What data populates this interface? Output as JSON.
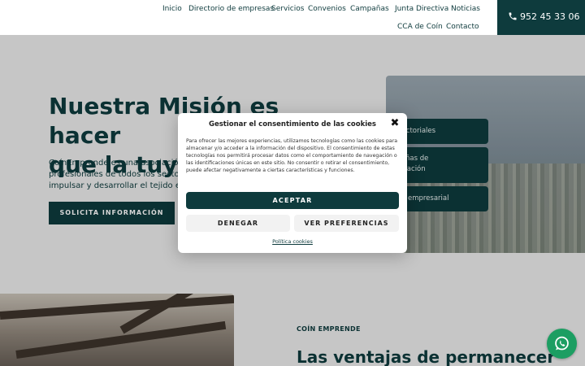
{
  "header": {
    "nav": [
      "Inicio",
      "Directorio de empresas",
      "Servicios",
      "Convenios",
      "Campañas",
      "Junta Directiva",
      "Noticias",
      "CCA de Coín",
      "Contacto"
    ],
    "phone": "952 45 33 06",
    "phone_icon": "phone-icon"
  },
  "hero": {
    "title_line1": "Nuestra Misión es hacer",
    "title_line2": "que la tuya s",
    "text_line1": "CoínEmprende es una asociación s",
    "text_line2": "profesionales de todos los sectores",
    "text_line3": "impulsar y desarrollar el tejido emp",
    "button": "SOLICITA INFORMACIÓN"
  },
  "side_cards": [
    "s sectoriales",
    "npañas de",
    "unicación",
    "oría empresarial"
  ],
  "section": {
    "eyebrow": "COÍN EMPRENDE",
    "title": "Las ventajas de permanecer"
  },
  "cookie_modal": {
    "title": "Gestionar el consentimiento de las cookies",
    "body": "Para ofrecer las mejores experiencias, utilizamos tecnologías como las cookies para almacenar y/o acceder a la información del dispositivo. El consentimiento de estas tecnologías nos permitirá procesar datos como el comportamiento de navegación o las identificaciones únicas en este sitio. No consentir o retirar el consentimiento, puede afectar negativamente a ciertas características y funciones.",
    "accept": "ACEPTAR",
    "deny": "DENEGAR",
    "preferences": "VER PREFERENCIAS",
    "policy_link": "Política cookies",
    "close_symbol": "✖"
  },
  "floating": {
    "whatsapp_icon": "whatsapp-icon"
  },
  "colors": {
    "brand": "#0e3b3d",
    "whatsapp": "#1c9e62"
  }
}
